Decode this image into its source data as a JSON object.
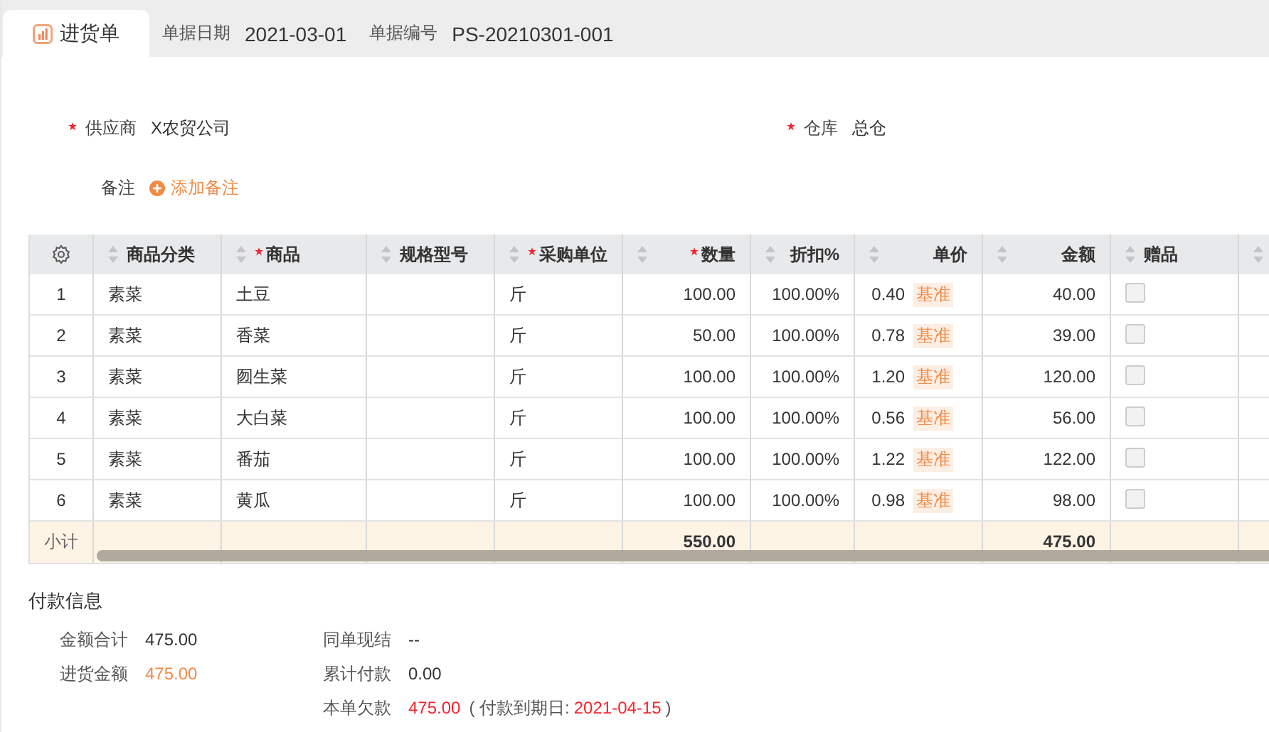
{
  "header": {
    "tab": {
      "label": "进货单",
      "selected": true
    },
    "fields": [
      {
        "label": "单据日期",
        "value": "2021-03-01"
      },
      {
        "label": "单据编号",
        "value": "PS-20210301-001"
      }
    ]
  },
  "form": {
    "fields": [
      {
        "label": "供应商",
        "required": true,
        "value": "X农贸公司"
      },
      {
        "label": "仓库",
        "required": true,
        "value": "总仓"
      }
    ],
    "remark": {
      "label": "备注",
      "action": "添加备注"
    }
  },
  "table": {
    "columns": [
      {
        "kind": "settings"
      },
      {
        "kind": "text",
        "label": "商品分类",
        "required": false
      },
      {
        "kind": "text",
        "label": "商品",
        "required": true
      },
      {
        "kind": "text",
        "label": "规格型号",
        "required": false
      },
      {
        "kind": "text",
        "label": "采购单位",
        "required": true
      },
      {
        "kind": "number",
        "label": "数量",
        "required": true
      },
      {
        "kind": "number",
        "label": "折扣%",
        "required": false
      },
      {
        "kind": "number",
        "label": "单价",
        "required": false
      },
      {
        "kind": "number",
        "label": "金额",
        "required": false
      },
      {
        "kind": "text",
        "label": "赠品",
        "required": false
      },
      {
        "kind": "cut"
      }
    ],
    "rows": [
      {
        "index": "1",
        "category": "素菜",
        "name": "土豆",
        "unit": "斤",
        "quantity": "100.00",
        "discount": "100.00%",
        "price": "0.40",
        "price_tag": "基准",
        "amount": "40.00",
        "gift": false
      },
      {
        "index": "2",
        "category": "素菜",
        "name": "香菜",
        "unit": "斤",
        "quantity": "50.00",
        "discount": "100.00%",
        "price": "0.78",
        "price_tag": "基准",
        "amount": "39.00",
        "gift": false
      },
      {
        "index": "3",
        "category": "素菜",
        "name": "囫生菜",
        "unit": "斤",
        "quantity": "100.00",
        "discount": "100.00%",
        "price": "1.20",
        "price_tag": "基准",
        "amount": "120.00",
        "gift": false
      },
      {
        "index": "4",
        "category": "素菜",
        "name": "大白菜",
        "unit": "斤",
        "quantity": "100.00",
        "discount": "100.00%",
        "price": "0.56",
        "price_tag": "基准",
        "amount": "56.00",
        "gift": false
      },
      {
        "index": "5",
        "category": "素菜",
        "name": "番茄",
        "unit": "斤",
        "quantity": "100.00",
        "discount": "100.00%",
        "price": "1.22",
        "price_tag": "基准",
        "amount": "122.00",
        "gift": false
      },
      {
        "index": "6",
        "category": "素菜",
        "name": "黄瓜",
        "unit": "斤",
        "quantity": "100.00",
        "discount": "100.00%",
        "price": "0.98",
        "price_tag": "基准",
        "amount": "98.00",
        "gift": false
      }
    ],
    "subtotal": {
      "label": "小计",
      "quantity": "550.00",
      "amount": "475.00"
    }
  },
  "payment": {
    "title": "付款信息",
    "left": [
      {
        "label": "金额合计",
        "value": "475.00",
        "kind": "plain"
      },
      {
        "label": "进货金额",
        "value": "475.00",
        "kind": "highlight"
      }
    ],
    "right": [
      {
        "label": "同单现结",
        "value": "--",
        "kind": "plain"
      },
      {
        "label": "累计付款",
        "value": "0.00",
        "kind": "plain"
      },
      {
        "label": "本单欠款",
        "value": "475.00",
        "kind": "due",
        "note_open": "( 付款到期日:",
        "note_value": "2021-04-15",
        "note_close": ")"
      }
    ]
  }
}
